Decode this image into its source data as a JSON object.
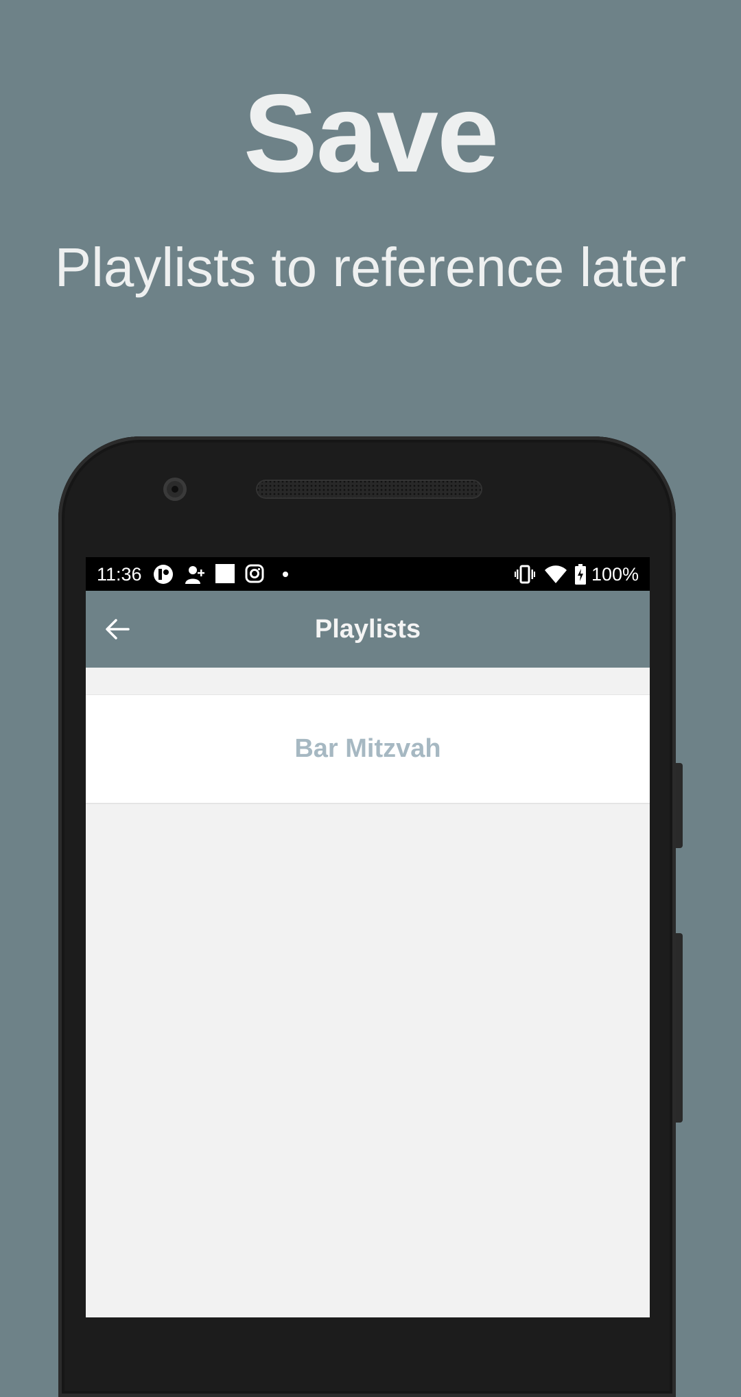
{
  "promo": {
    "headline": "Save",
    "subheadline": "Playlists to reference later"
  },
  "status_bar": {
    "time": "11:36",
    "battery_text": "100%",
    "icons": [
      "app-notification-icon",
      "add-contact-icon",
      "white-square-icon",
      "instagram-icon",
      "dot-icon",
      "vibrate-icon",
      "wifi-icon",
      "battery-charging-icon"
    ]
  },
  "app_bar": {
    "title": "Playlists",
    "back_icon": "arrow-left-icon"
  },
  "playlists": [
    {
      "label": "Bar Mitzvah"
    }
  ],
  "colors": {
    "background": "#6e8288",
    "app_bar": "#6e8288",
    "list_item_text": "#a6b8c2",
    "screen_bg": "#f2f2f2"
  }
}
